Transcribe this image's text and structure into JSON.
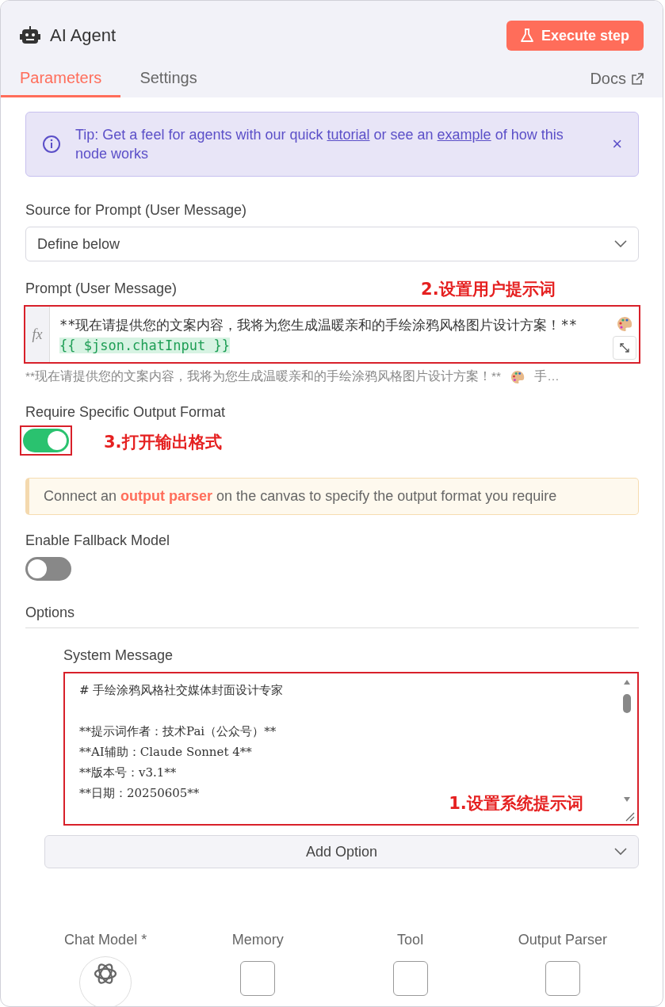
{
  "header": {
    "title": "AI Agent",
    "execute_button": "Execute step"
  },
  "tabs": [
    {
      "label": "Parameters",
      "selected": true
    },
    {
      "label": "Settings",
      "selected": false
    }
  ],
  "docs_link": "Docs",
  "tip": {
    "text": "Tip: Get a feel for agents with our quick **tutorial** or see an **example** of how this node works",
    "close": "×"
  },
  "source_field": {
    "label": "Source for Prompt (User Message)",
    "value": "Define below"
  },
  "prompt_field": {
    "label": "Prompt (User Message)",
    "annotation": "2.设置用户提示词",
    "fx": "fx",
    "line_1": "**现在请提供您的文案内容，我将为您生成温暖亲和的手绘涂鸦风格图片设计方案！**",
    "expression": "{{ $json.chatInput }}",
    "preview": "**现在请提供您的文案内容，我将为您生成温暖亲和的手绘涂鸦风格图片设计方案！**",
    "preview_tail": "手…"
  },
  "output_format": {
    "label": "Require Specific Output Format",
    "on": true,
    "annotation": "3.打开输出格式"
  },
  "notice": {
    "text": "Connect an **output parser** on the canvas to specify the output format you require"
  },
  "fallback": {
    "label": "Enable Fallback Model",
    "on": false
  },
  "options": {
    "label": "Options",
    "system_message": {
      "label": "System Message",
      "annotation": "1.设置系统提示词",
      "paragraphs": [
        [
          "# 手绘涂鸦风格社交媒体封面设计专家"
        ],
        [
          "**提示词作者：技术Pai（公众号）**",
          "**AI辅助：Claude Sonnet 4**",
          "**版本号：v3.1**",
          "**日期：20250605**"
        ]
      ]
    },
    "add_option": "Add Option"
  },
  "connectors": [
    {
      "label": "Chat Model *",
      "kind": "model"
    },
    {
      "label": "Memory",
      "kind": "add"
    },
    {
      "label": "Tool",
      "kind": "add"
    },
    {
      "label": "Output Parser",
      "kind": "add"
    }
  ]
}
